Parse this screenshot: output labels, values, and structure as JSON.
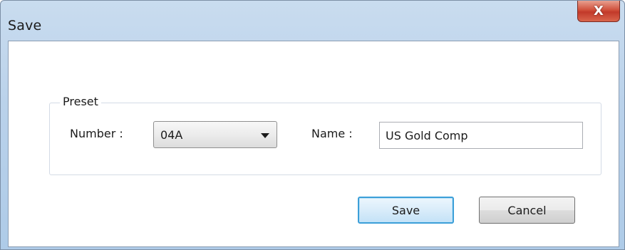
{
  "window": {
    "title": "Save",
    "close_glyph": "X"
  },
  "preset_group": {
    "label": "Preset"
  },
  "number_field": {
    "label": "Number :",
    "selected_value": "04A"
  },
  "name_field": {
    "label": "Name :",
    "value": "US Gold Comp"
  },
  "buttons": {
    "save_label": "Save",
    "cancel_label": "Cancel"
  },
  "colors": {
    "title_bar": "#b9d1ea",
    "close_button": "#c94532",
    "default_button_border": "#3c9fd8"
  },
  "icons": {
    "close": "close-icon",
    "dropdown": "chevron-down-icon"
  }
}
